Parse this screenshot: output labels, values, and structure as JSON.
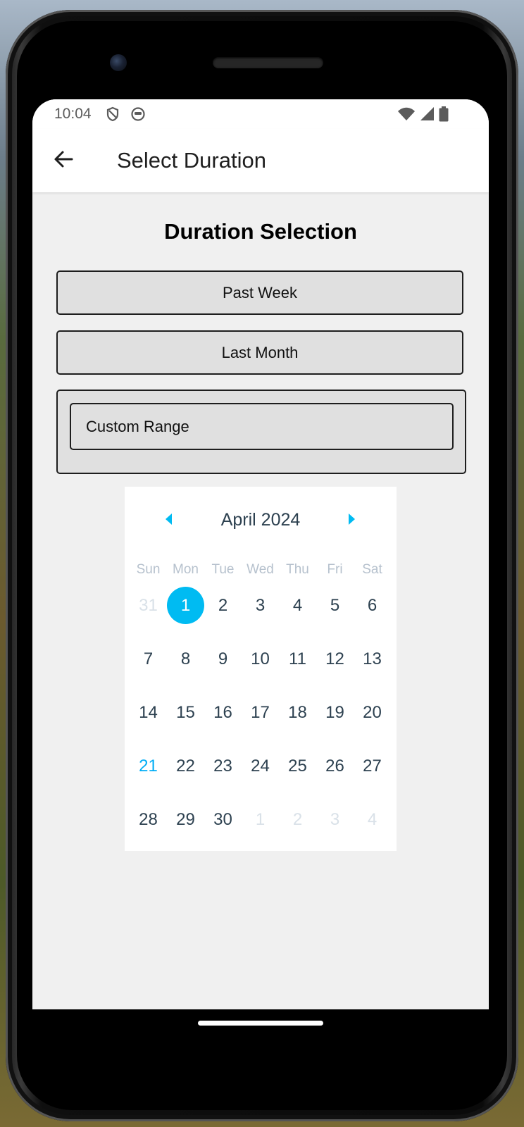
{
  "status_bar": {
    "time": "10:04"
  },
  "app_bar": {
    "title": "Select Duration",
    "back_icon": "arrow-left-icon"
  },
  "main": {
    "heading": "Duration Selection",
    "options": [
      {
        "label": "Past Week"
      },
      {
        "label": "Last Month"
      }
    ],
    "custom_range": {
      "value": "Custom Range"
    }
  },
  "calendar": {
    "month_label": "April 2024",
    "weekdays": [
      "Sun",
      "Mon",
      "Tue",
      "Wed",
      "Thu",
      "Fri",
      "Sat"
    ],
    "weeks": [
      [
        {
          "d": "31",
          "muted": true
        },
        {
          "d": "1",
          "selected": true
        },
        {
          "d": "2"
        },
        {
          "d": "3"
        },
        {
          "d": "4"
        },
        {
          "d": "5"
        },
        {
          "d": "6"
        }
      ],
      [
        {
          "d": "7"
        },
        {
          "d": "8"
        },
        {
          "d": "9"
        },
        {
          "d": "10"
        },
        {
          "d": "11"
        },
        {
          "d": "12"
        },
        {
          "d": "13"
        }
      ],
      [
        {
          "d": "14"
        },
        {
          "d": "15"
        },
        {
          "d": "16"
        },
        {
          "d": "17"
        },
        {
          "d": "18"
        },
        {
          "d": "19"
        },
        {
          "d": "20"
        }
      ],
      [
        {
          "d": "21",
          "today": true
        },
        {
          "d": "22"
        },
        {
          "d": "23"
        },
        {
          "d": "24"
        },
        {
          "d": "25"
        },
        {
          "d": "26"
        },
        {
          "d": "27"
        }
      ],
      [
        {
          "d": "28"
        },
        {
          "d": "29"
        },
        {
          "d": "30"
        },
        {
          "d": "1",
          "muted": true
        },
        {
          "d": "2",
          "muted": true
        },
        {
          "d": "3",
          "muted": true
        },
        {
          "d": "4",
          "muted": true
        }
      ]
    ]
  },
  "colors": {
    "accent": "#00bbf2",
    "today_text": "#00adf5",
    "day_text": "#2d4150",
    "muted_text": "#d9e1e8",
    "weekday_text": "#b6c1cd",
    "button_bg": "#e0e0e0",
    "screen_bg": "#f0f0f0"
  }
}
